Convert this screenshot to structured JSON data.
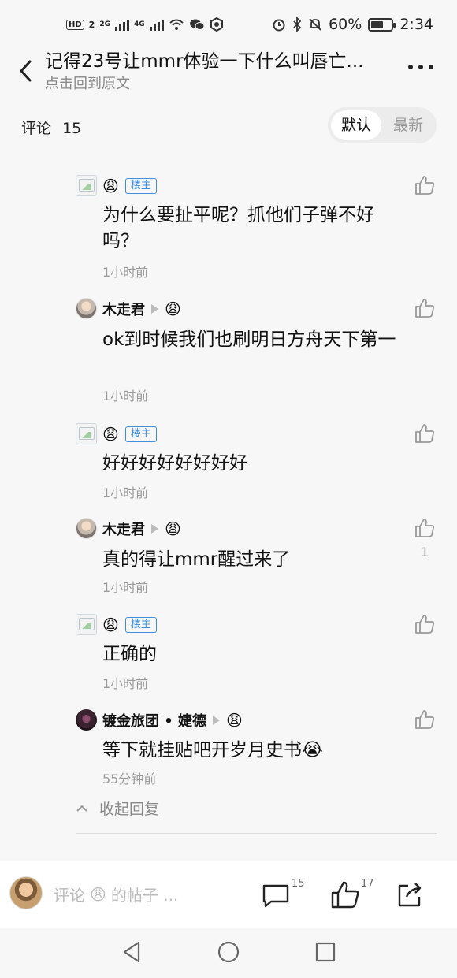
{
  "status_bar": {
    "network_type": "HD",
    "sim_1": "2",
    "signal_1_label": "2G",
    "signal_2_label": "4G",
    "battery_percent": "60%",
    "time": "2:34"
  },
  "header": {
    "title": "记得23号让mmr体验一下什么叫唇亡...",
    "subtitle": "点击回到原文"
  },
  "comments": {
    "label": "评论",
    "count": "15",
    "sort_default": "默认",
    "sort_newest": "最新"
  },
  "replies": [
    {
      "username": "",
      "emoji": "😩",
      "badge": "楼主",
      "content": "为什么要扯平呢？抓他们子弹不好吗？",
      "time": "1小时前",
      "likes": ""
    },
    {
      "username": "木走君",
      "emoji": "😩",
      "badge": "",
      "content": "ok到时候我们也刷明日方舟天下第一",
      "time": "1小时前",
      "likes": ""
    },
    {
      "username": "",
      "emoji": "😩",
      "badge": "楼主",
      "content": "好好好好好好好好",
      "time": "1小时前",
      "likes": ""
    },
    {
      "username": "木走君",
      "emoji": "😩",
      "badge": "",
      "content": "真的得让mmr醒过来了",
      "time": "1小时前",
      "likes": "1"
    },
    {
      "username": "",
      "emoji": "😩",
      "badge": "楼主",
      "content": "正确的",
      "time": "1小时前",
      "likes": ""
    },
    {
      "username": "镀金旅团 • 婕德",
      "emoji": "😩",
      "badge": "",
      "content": "等下就挂贴吧开岁月史书😭",
      "time": "55分钟前",
      "likes": ""
    }
  ],
  "collapse_label": "收起回复",
  "bottom_bar": {
    "input_prefix": "评论",
    "input_emoji": "😩",
    "input_suffix": "的帖子 ...",
    "comment_count": "15",
    "like_count": "17"
  },
  "icons": {
    "back": "chevron-left-icon",
    "more": "more-dots-icon",
    "like": "thumbs-up-icon",
    "comment": "comment-bubble-icon",
    "share": "share-icon"
  }
}
